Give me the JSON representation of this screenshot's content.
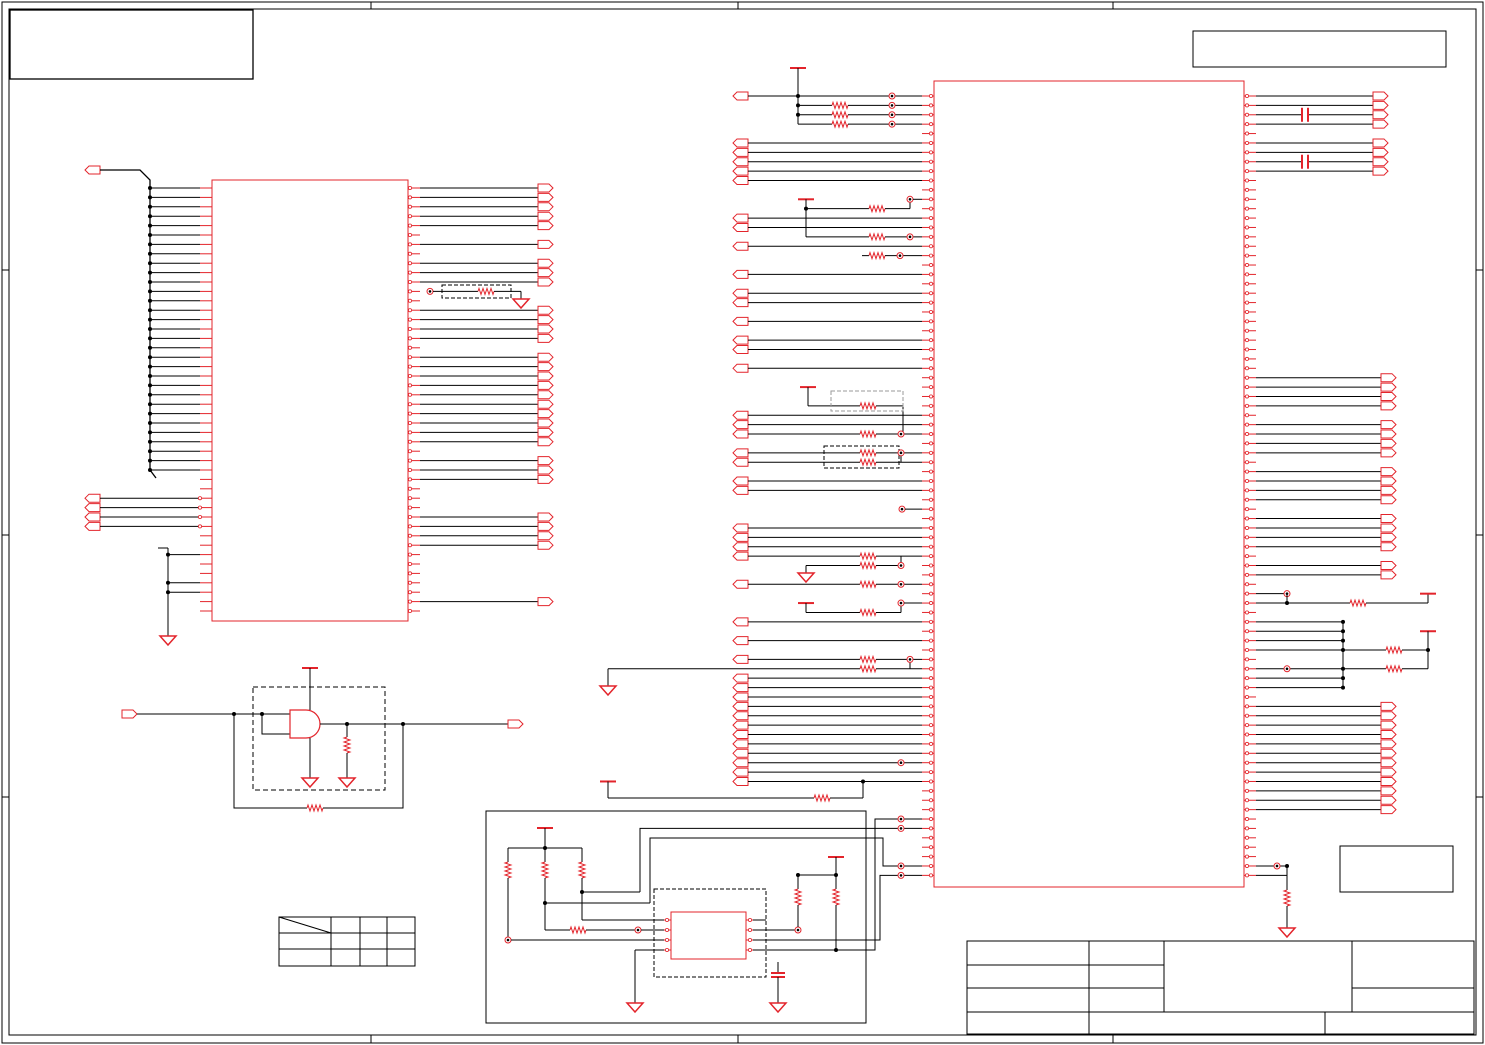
{
  "colors": {
    "component": "#e3242b",
    "wire": "#000000",
    "frame": "#000000",
    "dashed_box": "#000000",
    "dashed_box_light": "#9a9a9a",
    "background": "#ffffff"
  }
}
